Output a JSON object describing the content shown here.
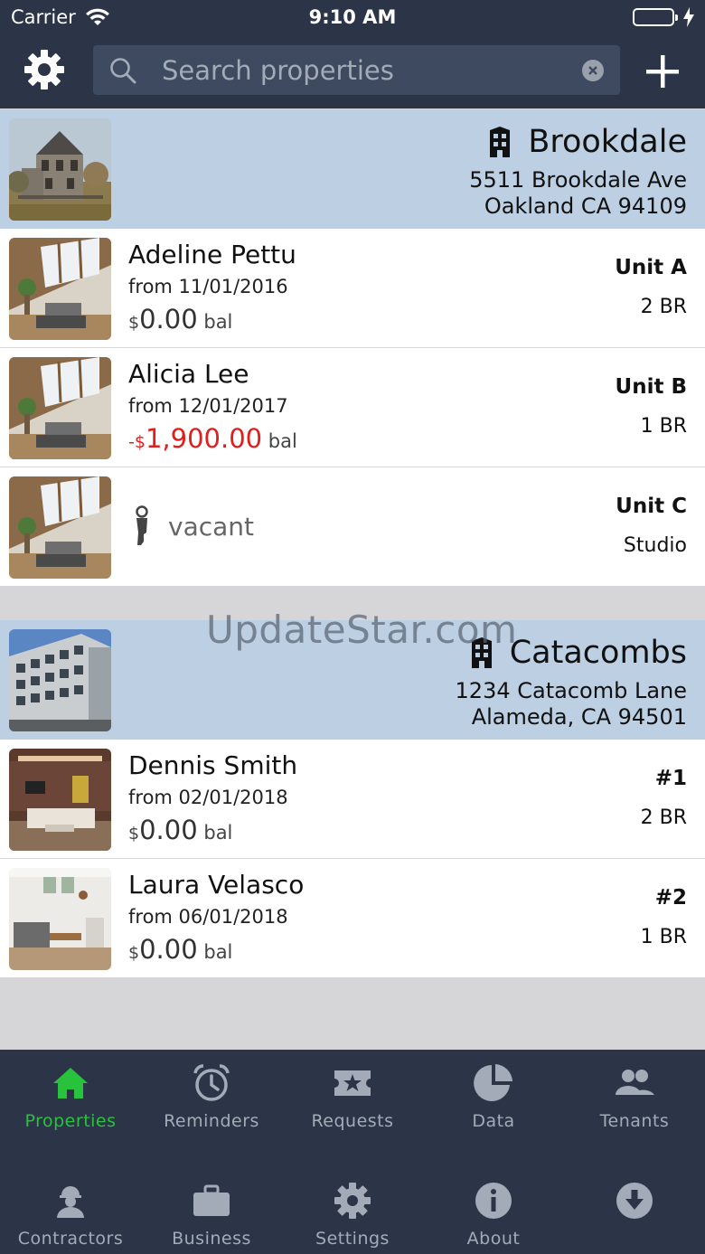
{
  "status_bar": {
    "carrier": "Carrier",
    "time": "9:10 AM"
  },
  "header": {
    "search_placeholder": "Search properties"
  },
  "properties": [
    {
      "name": "Brookdale",
      "address_line1": "5511 Brookdale Ave",
      "address_line2": "Oakland CA 94109",
      "units": [
        {
          "tenant": "Adeline Pettu",
          "since": "from 11/01/2016",
          "currency": "$",
          "amount": "0.00",
          "prefix": "",
          "suffix": "bal",
          "unit": "Unit A",
          "size": "2 BR"
        },
        {
          "tenant": "Alicia Lee",
          "since": "from 12/01/2017",
          "currency": "$",
          "amount": "1,900.00",
          "prefix": "-",
          "suffix": "bal",
          "unit": "Unit B",
          "size": "1 BR"
        },
        {
          "vacant_label": "vacant",
          "unit": "Unit C",
          "size": "Studio"
        }
      ]
    },
    {
      "name": "Catacombs",
      "address_line1": "1234 Catacomb Lane",
      "address_line2": "Alameda, CA 94501",
      "units": [
        {
          "tenant": "Dennis Smith",
          "since": "from 02/01/2018",
          "currency": "$",
          "amount": "0.00",
          "prefix": "",
          "suffix": "bal",
          "unit": "#1",
          "size": "2 BR"
        },
        {
          "tenant": "Laura Velasco",
          "since": "from 06/01/2018",
          "currency": "$",
          "amount": "0.00",
          "prefix": "",
          "suffix": "bal",
          "unit": "#2",
          "size": "1 BR"
        }
      ]
    }
  ],
  "watermark": "UpdateStar.com",
  "tabs": [
    {
      "label": "Properties",
      "icon": "home-icon",
      "active": true
    },
    {
      "label": "Reminders",
      "icon": "alarm-clock-icon"
    },
    {
      "label": "Requests",
      "icon": "ticket-star-icon"
    },
    {
      "label": "Data",
      "icon": "pie-chart-icon"
    },
    {
      "label": "Tenants",
      "icon": "people-icon"
    },
    {
      "label": "Contractors",
      "icon": "worker-icon"
    },
    {
      "label": "Business",
      "icon": "briefcase-icon"
    },
    {
      "label": "Settings",
      "icon": "gear-icon"
    },
    {
      "label": "About",
      "icon": "info-icon"
    },
    {
      "label": "",
      "icon": "download-icon"
    }
  ],
  "colors": {
    "header_bg": "#2b3547",
    "property_header_bg": "#bccfe3",
    "active_tab": "#28c23c",
    "inactive_tab": "#a4abb8",
    "negative_balance": "#e01e1e"
  }
}
